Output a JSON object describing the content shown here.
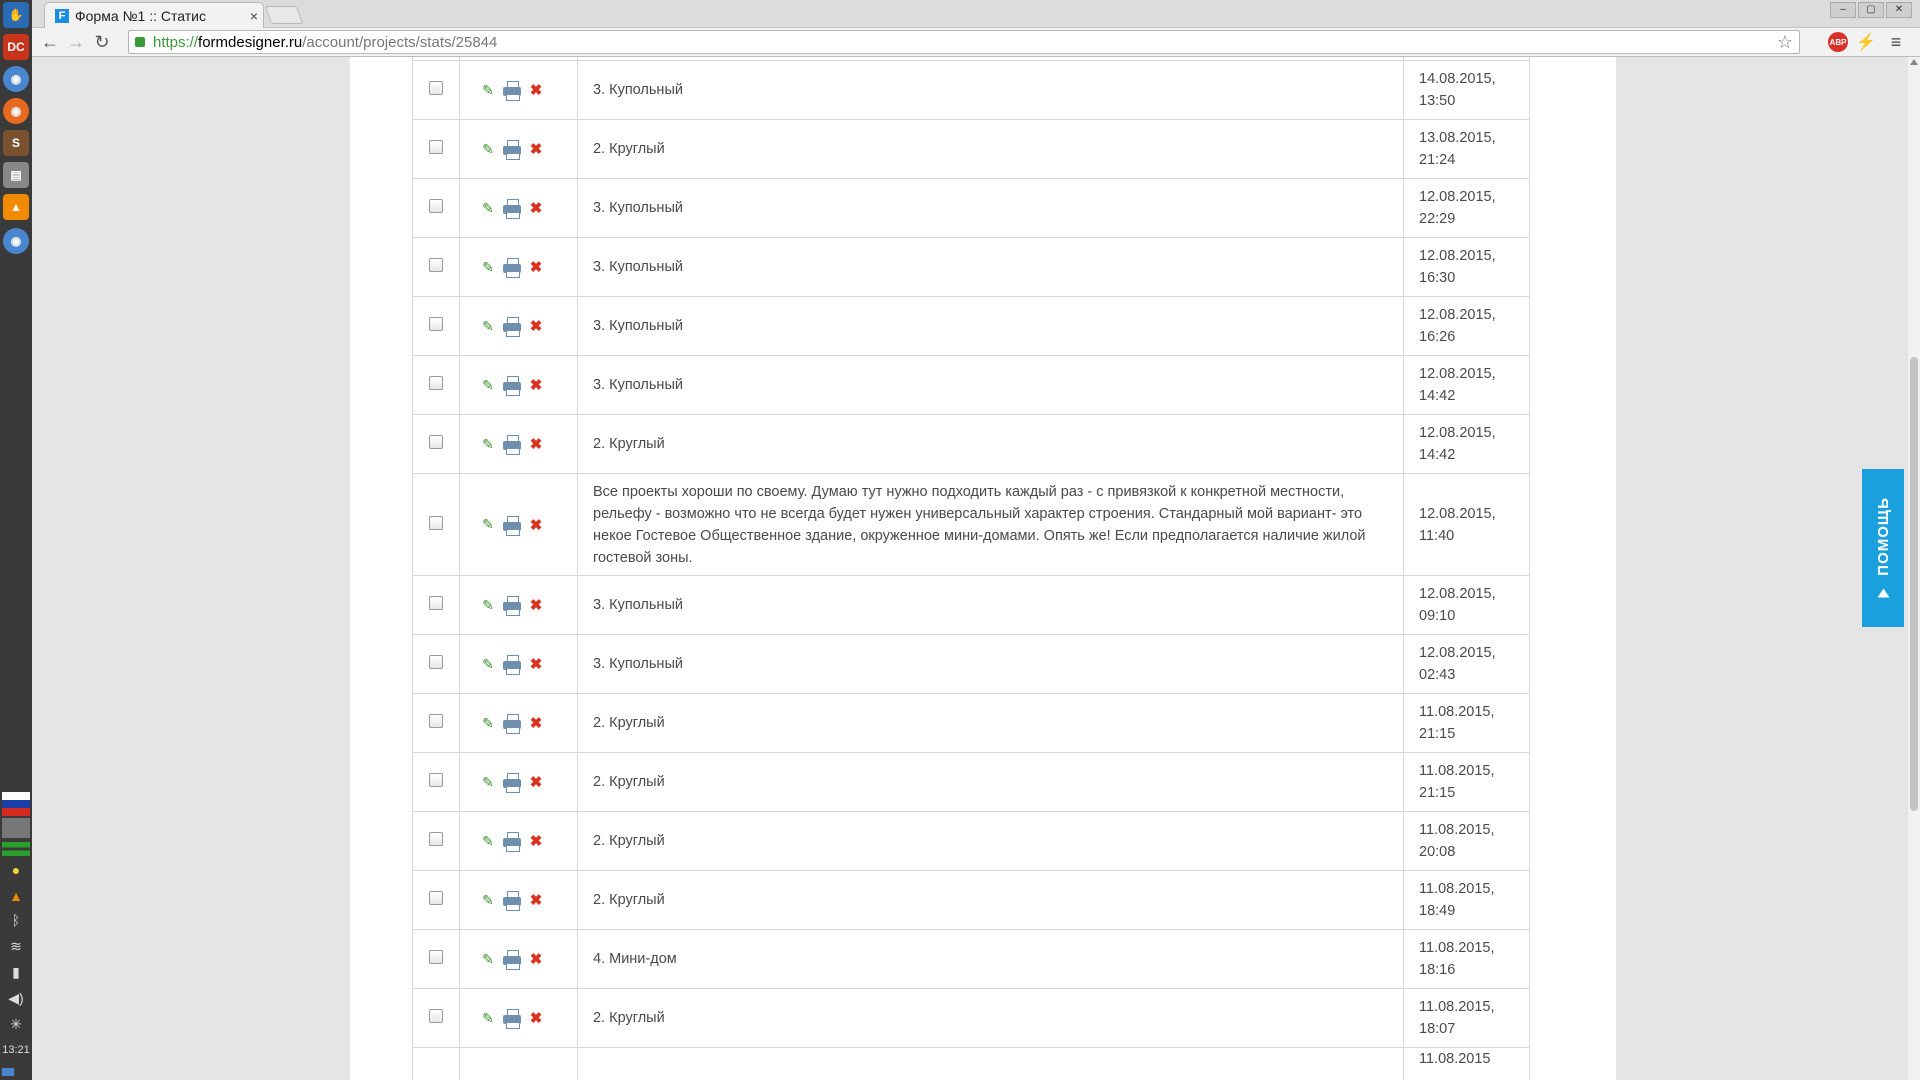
{
  "browser": {
    "tab_favicon": "F",
    "tab_title": "Форма №1 :: Статис",
    "tab_close": "×",
    "url_scheme": "https://",
    "url_host": "formdesigner.ru",
    "url_path": "/account/projects/stats/25844",
    "extensions": [
      "ABP",
      "⚡",
      "≡"
    ]
  },
  "system_panel": {
    "time": "13:21",
    "icons": [
      "start-icon",
      "dc-icon",
      "chromium-icon",
      "firefox-icon",
      "s-app-icon",
      "drive-icon",
      "vlc-icon",
      "chromium-icon",
      "flag-ru-icon",
      "bulb-icon",
      "bluetooth-icon",
      "wifi-icon",
      "battery-icon",
      "volume-icon",
      "clock-icon"
    ]
  },
  "help": {
    "label": "ПОМОЩЬ",
    "color": "#1aa0dd"
  },
  "rows": [
    {
      "text": "3. Купольный",
      "date": "14.08.2015,",
      "time": "13:50"
    },
    {
      "text": "2. Круглый",
      "date": "13.08.2015,",
      "time": "21:24"
    },
    {
      "text": "3. Купольный",
      "date": "12.08.2015,",
      "time": "22:29"
    },
    {
      "text": "3. Купольный",
      "date": "12.08.2015,",
      "time": "16:30"
    },
    {
      "text": "3. Купольный",
      "date": "12.08.2015,",
      "time": "16:26"
    },
    {
      "text": "3. Купольный",
      "date": "12.08.2015,",
      "time": "14:42"
    },
    {
      "text": "2. Круглый",
      "date": "12.08.2015,",
      "time": "14:42"
    },
    {
      "text": "Все проекты хороши по своему. Думаю тут нужно подходить каждый раз - с привязкой к конкретной местности, рельефу - возможно что не всегда будет нужен универсальный характер строения. Стандарный мой вариант- это некое Гостевое Общественное здание, окруженное мини-домами. Опять же! Если предполагается наличие жилой гостевой зоны.",
      "date": "12.08.2015,",
      "time": "11:40"
    },
    {
      "text": "3. Купольный",
      "date": "12.08.2015,",
      "time": "09:10"
    },
    {
      "text": "3. Купольный",
      "date": "12.08.2015,",
      "time": "02:43"
    },
    {
      "text": "2. Круглый",
      "date": "11.08.2015,",
      "time": "21:15"
    },
    {
      "text": "2. Круглый",
      "date": "11.08.2015,",
      "time": "21:15"
    },
    {
      "text": "2. Круглый",
      "date": "11.08.2015,",
      "time": "20:08"
    },
    {
      "text": "2. Круглый",
      "date": "11.08.2015,",
      "time": "18:49"
    },
    {
      "text": "4. Мини-дом",
      "date": "11.08.2015,",
      "time": "18:16"
    },
    {
      "text": "2. Круглый",
      "date": "11.08.2015,",
      "time": "18:07"
    },
    {
      "text": "",
      "date": "11.08.2015",
      "time": ""
    }
  ]
}
